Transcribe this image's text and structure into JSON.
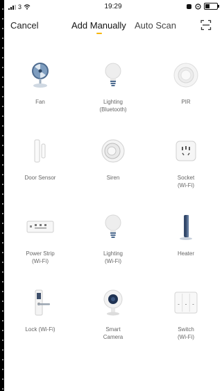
{
  "status": {
    "carrier": "3",
    "time": "19:29"
  },
  "nav": {
    "cancel": "Cancel",
    "tabs": [
      "Add Manually",
      "Auto Scan"
    ],
    "accent": "#f7b500"
  },
  "devices": [
    {
      "label": "Fan",
      "sub": "",
      "icon": "fan-icon"
    },
    {
      "label": "Lighting",
      "sub": "(Bluetooth)",
      "icon": "bulb-icon"
    },
    {
      "label": "PIR",
      "sub": "",
      "icon": "pir-icon"
    },
    {
      "label": "Door Sensor",
      "sub": "",
      "icon": "door-sensor-icon"
    },
    {
      "label": "Siren",
      "sub": "",
      "icon": "siren-icon"
    },
    {
      "label": "Socket",
      "sub": "(Wi-Fi)",
      "icon": "socket-icon"
    },
    {
      "label": "Power Strip",
      "sub": "(Wi-Fi)",
      "icon": "power-strip-icon"
    },
    {
      "label": "Lighting",
      "sub": "(Wi-Fi)",
      "icon": "bulb-icon"
    },
    {
      "label": "Heater",
      "sub": "",
      "icon": "heater-icon"
    },
    {
      "label": "Lock (Wi-Fi)",
      "sub": "",
      "icon": "lock-icon"
    },
    {
      "label": "Smart",
      "sub": "Camera",
      "icon": "camera-icon"
    },
    {
      "label": "Switch",
      "sub": "(Wi-Fi)",
      "icon": "switch-icon"
    }
  ]
}
